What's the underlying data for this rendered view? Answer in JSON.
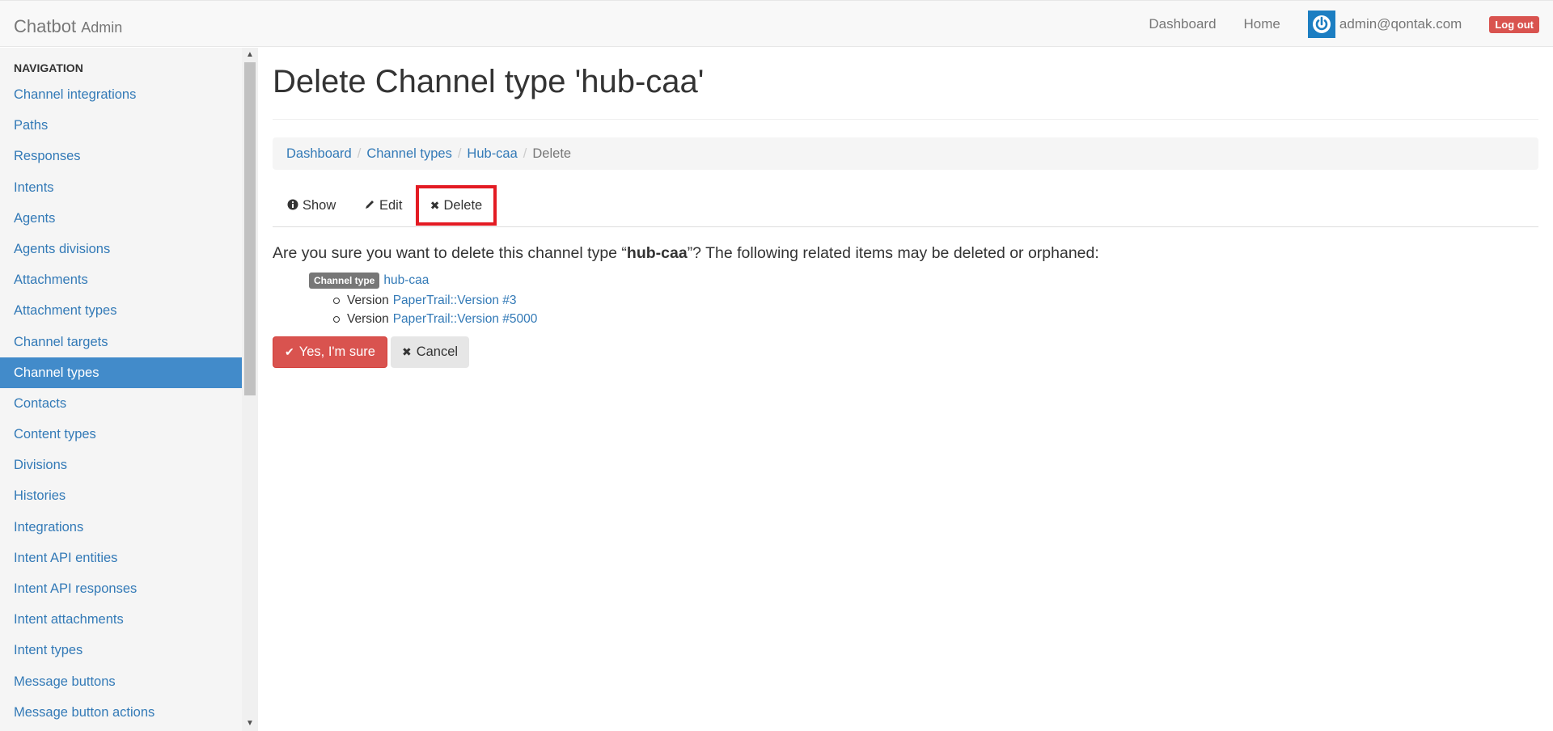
{
  "navbar": {
    "brand": "Chatbot",
    "brand_sub": "Admin",
    "links": [
      "Dashboard",
      "Home"
    ],
    "user_email": "admin@qontak.com",
    "logout_label": "Log out"
  },
  "sidebar": {
    "heading": "NAVIGATION",
    "items": [
      {
        "label": "Channel integrations"
      },
      {
        "label": "Paths"
      },
      {
        "label": "Responses"
      },
      {
        "label": "Intents"
      },
      {
        "label": "Agents"
      },
      {
        "label": "Agents divisions"
      },
      {
        "label": "Attachments"
      },
      {
        "label": "Attachment types"
      },
      {
        "label": "Channel targets"
      },
      {
        "label": "Channel types",
        "active": true
      },
      {
        "label": "Contacts"
      },
      {
        "label": "Content types"
      },
      {
        "label": "Divisions"
      },
      {
        "label": "Histories"
      },
      {
        "label": "Integrations"
      },
      {
        "label": "Intent API entities"
      },
      {
        "label": "Intent API responses"
      },
      {
        "label": "Intent attachments"
      },
      {
        "label": "Intent types"
      },
      {
        "label": "Message buttons"
      },
      {
        "label": "Message button actions"
      }
    ]
  },
  "main": {
    "title": "Delete Channel type 'hub-caa'",
    "breadcrumb": [
      "Dashboard",
      "Channel types",
      "Hub-caa",
      "Delete"
    ],
    "tabs": {
      "show": "Show",
      "edit": "Edit",
      "delete": "Delete"
    },
    "confirm": {
      "before": "Are you sure you want to delete this channel type “",
      "name": "hub-caa",
      "after": "”? The following related items may be deleted or orphaned:"
    },
    "related": {
      "badge": "Channel type",
      "link": "hub-caa",
      "children": [
        {
          "prefix": "Version",
          "link": "PaperTrail::Version #3"
        },
        {
          "prefix": "Version",
          "link": "PaperTrail::Version #5000"
        }
      ]
    },
    "buttons": {
      "confirm": "Yes, I'm sure",
      "cancel": "Cancel"
    }
  },
  "colors": {
    "link": "#337ab7",
    "active_nav": "#428bca",
    "danger": "#d9534f",
    "highlight_box": "#e31b23"
  }
}
